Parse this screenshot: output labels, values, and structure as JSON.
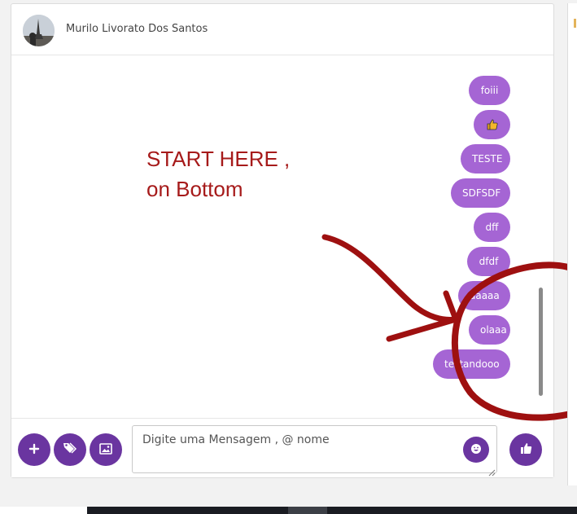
{
  "header": {
    "contact_name": "Murilo Livorato Dos Santos"
  },
  "messages": [
    {
      "text": "foiii"
    },
    {
      "text": "",
      "icon": "thumbs-up-emoji-icon"
    },
    {
      "text": "TESTE"
    },
    {
      "text": "SDFSDF"
    },
    {
      "text": "dff"
    },
    {
      "text": "dfdf"
    },
    {
      "text": "aaaaa"
    },
    {
      "text": "olaaa"
    },
    {
      "text": "testandooo"
    }
  ],
  "annotation": {
    "line1": "START HERE ,",
    "line2": "on Bottom",
    "color": "#a61a1a"
  },
  "composer": {
    "placeholder": "Digite uma Mensagem , @ nome"
  },
  "colors": {
    "bubble": "#a565d4",
    "button": "#6a35a0"
  }
}
